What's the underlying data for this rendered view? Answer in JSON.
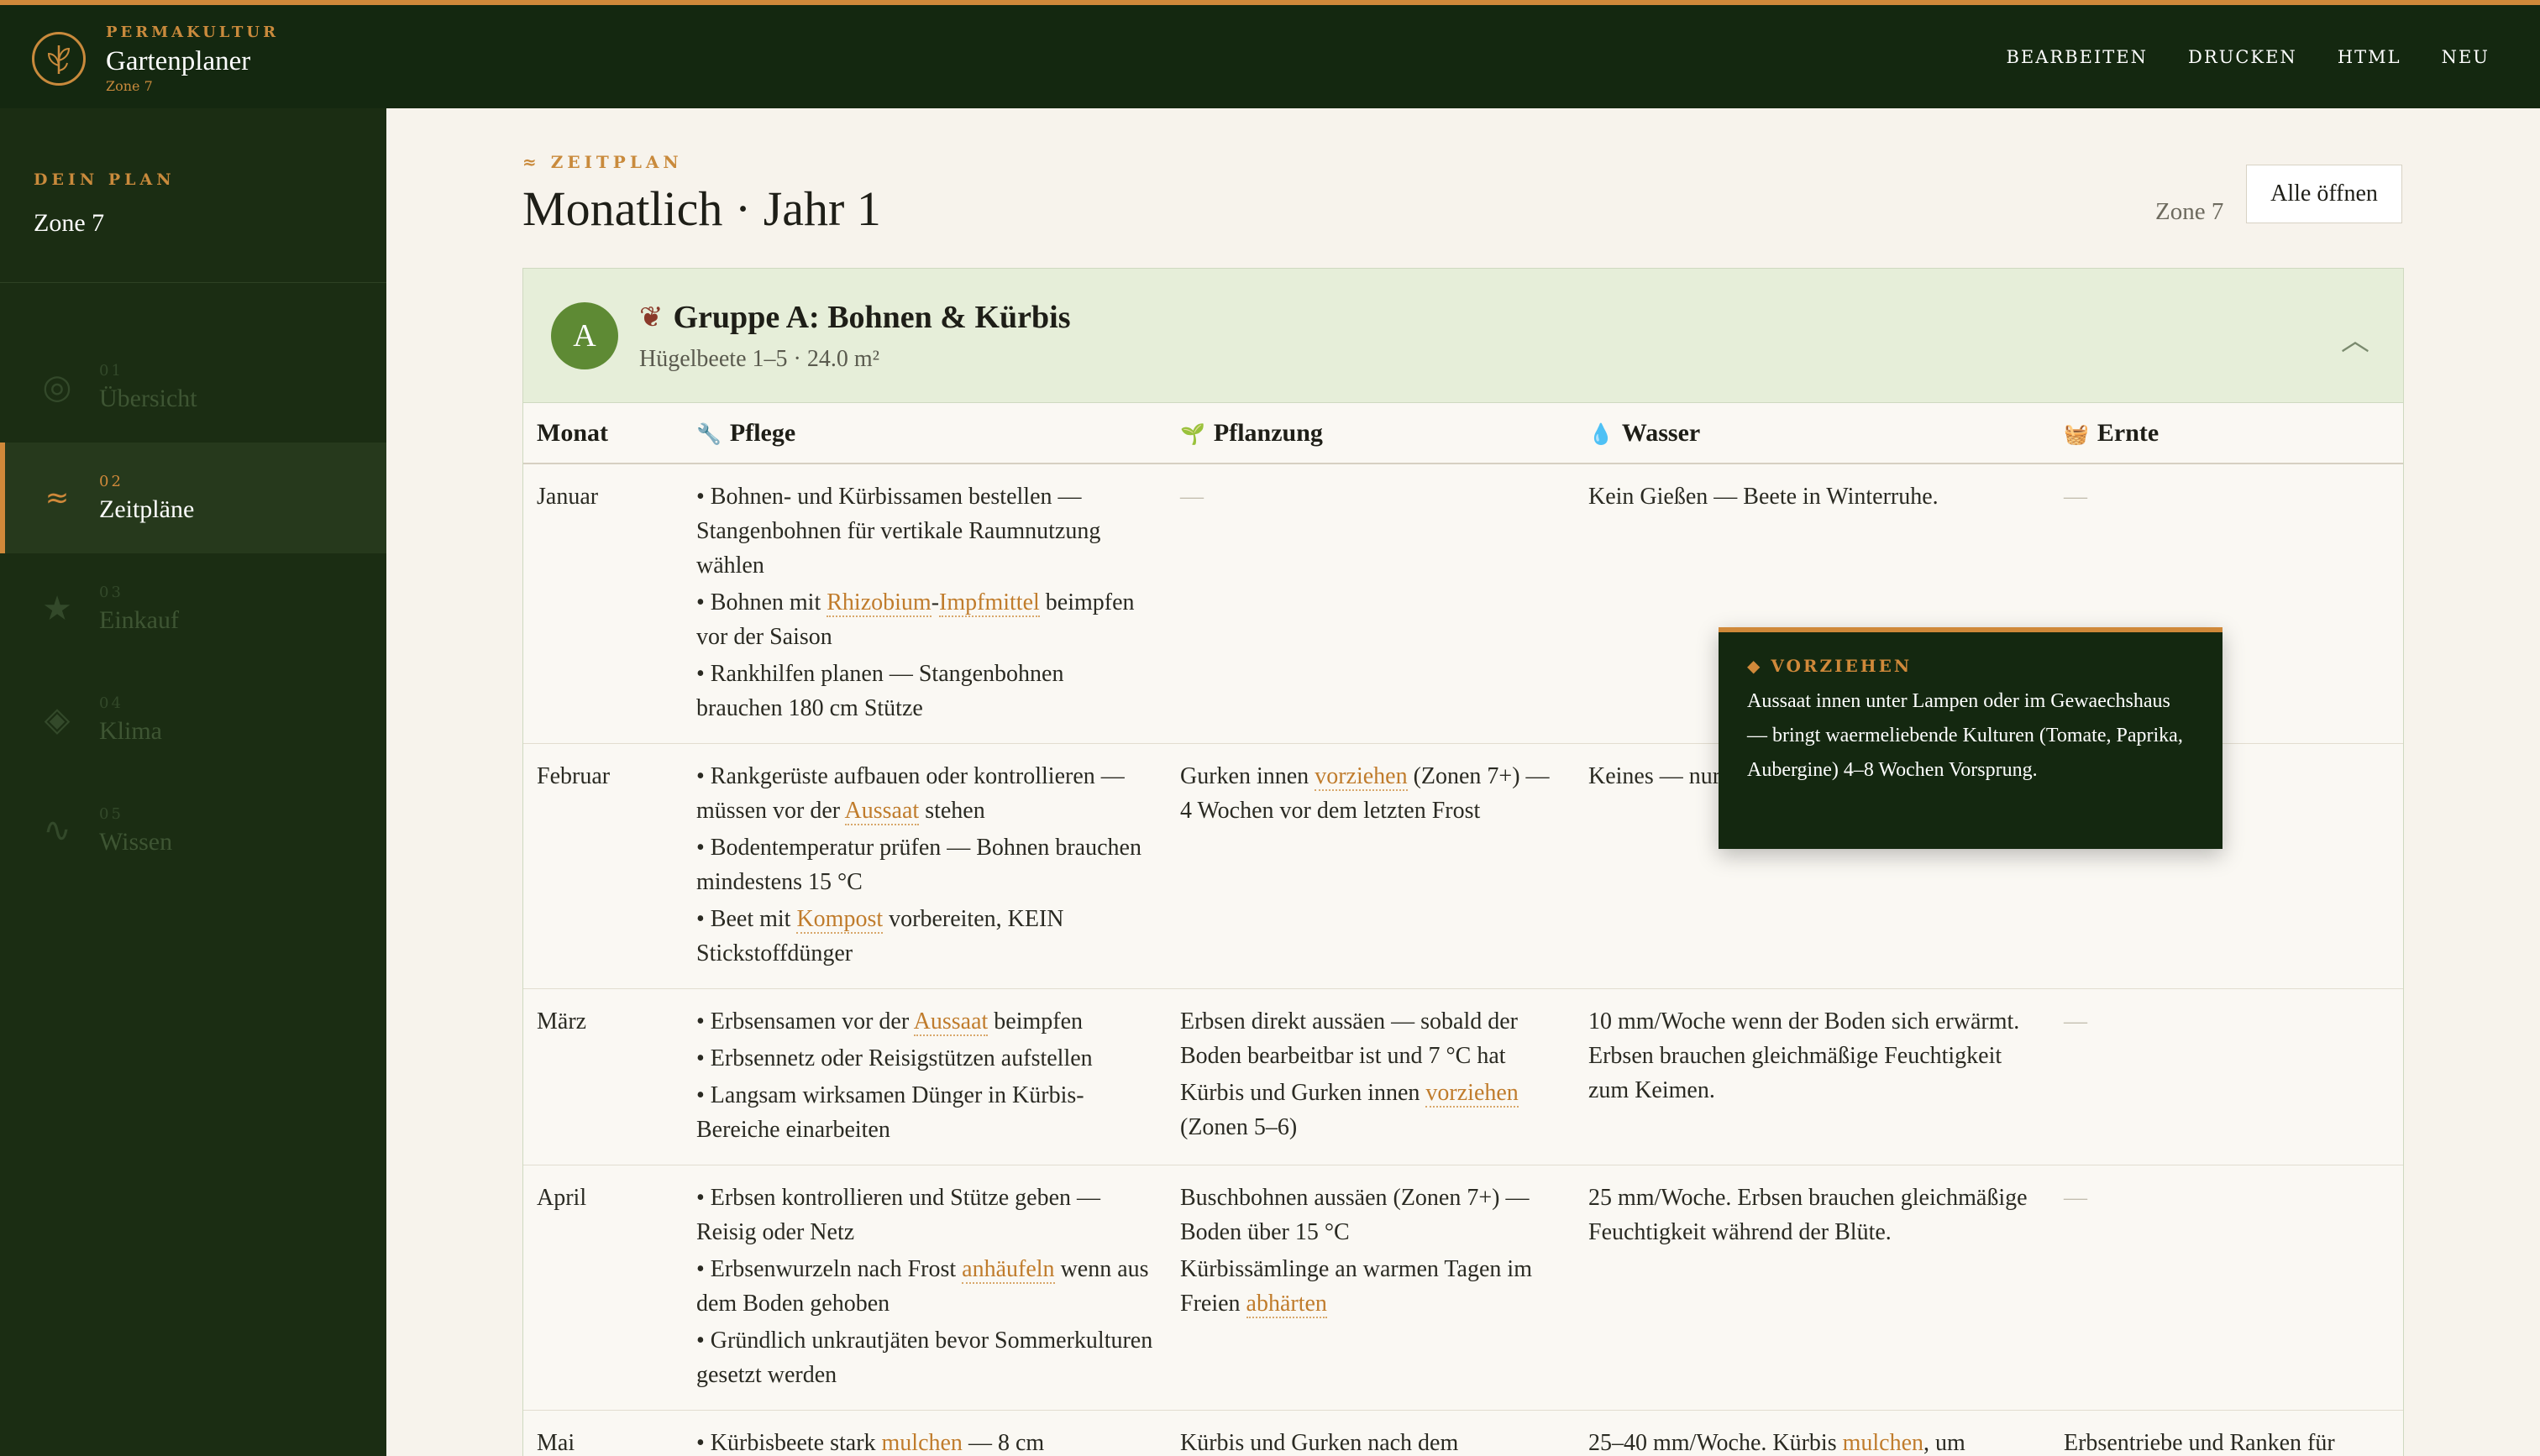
{
  "brand": {
    "eyebrow": "PERMAKULTUR",
    "title": "Gartenplaner",
    "zone": "Zone 7",
    "logo_icon": "leaf-spiral-icon"
  },
  "topnav": [
    "BEARBEITEN",
    "DRUCKEN",
    "HTML",
    "NEU"
  ],
  "sidebar": {
    "label": "DEIN PLAN",
    "zone": "Zone 7",
    "items": [
      {
        "num": "01",
        "name": "Übersicht",
        "icon": "◎",
        "active": false
      },
      {
        "num": "02",
        "name": "Zeitpläne",
        "icon": "≈",
        "active": true
      },
      {
        "num": "03",
        "name": "Einkauf",
        "icon": "★",
        "active": false
      },
      {
        "num": "04",
        "name": "Klima",
        "icon": "◈",
        "active": false
      },
      {
        "num": "05",
        "name": "Wissen",
        "icon": "∿",
        "active": false
      }
    ]
  },
  "header": {
    "eyebrow": "≈ ZEITPLAN",
    "title": "Monatlich · Jahr 1",
    "zone": "Zone 7",
    "open_all": "Alle öffnen"
  },
  "group": {
    "badge": "A",
    "emoji": "❦",
    "title": "Gruppe A: Bohnen & Kürbis",
    "subtitle": "Hügelbeete 1–5 · 24.0 m²",
    "chevron": "︿"
  },
  "table": {
    "headers": [
      {
        "label": "Monat",
        "icon": ""
      },
      {
        "label": "Pflege",
        "icon": "🔧"
      },
      {
        "label": "Pflanzung",
        "icon": "🌱"
      },
      {
        "label": "Wasser",
        "icon": "💧"
      },
      {
        "label": "Ernte",
        "icon": "🧺"
      }
    ],
    "rows": [
      {
        "month": "Januar",
        "care": [
          [
            {
              "t": "• Bohnen- und Kürbissamen bestellen — Stangenbohnen für vertikale Raumnutzung wählen"
            }
          ],
          [
            {
              "t": "• Bohnen mit "
            },
            {
              "t": "Rhizobium",
              "link": true
            },
            {
              "t": "-"
            },
            {
              "t": "Impfmittel",
              "link": true
            },
            {
              "t": " beimpfen vor der Saison"
            }
          ],
          [
            {
              "t": "• Rankhilfen planen — Stangenbohnen brauchen 180 cm Stütze"
            }
          ]
        ],
        "plant": [
          [
            {
              "t": "—",
              "dash": true
            }
          ]
        ],
        "water": [
          [
            {
              "t": "Kein Gießen — Beete in Winterruhe."
            }
          ]
        ],
        "harvest": [
          [
            {
              "t": "—",
              "dash": true
            }
          ]
        ]
      },
      {
        "month": "Februar",
        "care": [
          [
            {
              "t": "• Rankgerüste aufbauen oder kontrollieren — müssen vor der "
            },
            {
              "t": "Aussaat",
              "link": true
            },
            {
              "t": " stehen"
            }
          ],
          [
            {
              "t": "• Bodentemperatur prüfen — Bohnen brauchen mindestens 15 °C"
            }
          ],
          [
            {
              "t": "• Beet mit "
            },
            {
              "t": "Kompost",
              "link": true
            },
            {
              "t": " vorbereiten, KEIN Stickstoffdünger"
            }
          ]
        ],
        "plant": [
          [
            {
              "t": "Gurken innen "
            },
            {
              "t": "vorziehen",
              "link": true
            },
            {
              "t": " (Zonen 7+) — 4 Wochen vor dem letzten Frost"
            }
          ]
        ],
        "water": [
          [
            {
              "t": "Keines — nur bei Innenaussaat beginnen."
            }
          ]
        ],
        "harvest": [
          [
            {
              "t": "—",
              "dash": true
            }
          ]
        ]
      },
      {
        "month": "März",
        "care": [
          [
            {
              "t": "• Erbsensamen vor der "
            },
            {
              "t": "Aussaat",
              "link": true
            },
            {
              "t": " beimpfen"
            }
          ],
          [
            {
              "t": "• Erbsennetz oder Reisigstützen aufstellen"
            }
          ],
          [
            {
              "t": "• Langsam wirksamen Dünger in Kürbis-Bereiche einarbeiten"
            }
          ]
        ],
        "plant": [
          [
            {
              "t": "Erbsen direkt aussäen — sobald der Boden bearbeitbar ist und 7 °C hat"
            }
          ],
          [
            {
              "t": "Kürbis und Gurken innen "
            },
            {
              "t": "vorziehen",
              "link": true
            },
            {
              "t": " (Zonen 5–6)"
            }
          ]
        ],
        "water": [
          [
            {
              "t": "10 mm/Woche wenn der Boden sich erwärmt. Erbsen brauchen gleichmäßige Feuchtigkeit zum Keimen."
            }
          ]
        ],
        "harvest": [
          [
            {
              "t": "—",
              "dash": true
            }
          ]
        ]
      },
      {
        "month": "April",
        "care": [
          [
            {
              "t": "• Erbsen kontrollieren und Stütze geben — Reisig oder Netz"
            }
          ],
          [
            {
              "t": "• Erbsenwurzeln nach Frost "
            },
            {
              "t": "anhäufeln",
              "link": true
            },
            {
              "t": " wenn aus dem Boden gehoben"
            }
          ],
          [
            {
              "t": "• Gründlich unkrautjäten bevor Sommerkulturen gesetzt werden"
            }
          ]
        ],
        "plant": [
          [
            {
              "t": "Buschbohnen aussäen (Zonen 7+) — Boden über 15 °C"
            }
          ],
          [
            {
              "t": "Kürbissämlinge an warmen Tagen im Freien "
            },
            {
              "t": "abhärten",
              "link": true
            }
          ]
        ],
        "water": [
          [
            {
              "t": "25 mm/Woche. Erbsen brauchen gleichmäßige Feuchtigkeit während der Blüte."
            }
          ]
        ],
        "harvest": [
          [
            {
              "t": "—",
              "dash": true
            }
          ]
        ]
      },
      {
        "month": "Mai",
        "care": [
          [
            {
              "t": "• Kürbisbeete stark "
            },
            {
              "t": "mulchen",
              "link": true
            },
            {
              "t": " — 8 cm"
            }
          ]
        ],
        "plant": [
          [
            {
              "t": "Kürbis und Gurken nach dem"
            }
          ]
        ],
        "water": [
          [
            {
              "t": "25–40 mm/Woche. Kürbis "
            },
            {
              "t": "mulchen",
              "link": true
            },
            {
              "t": ", um"
            }
          ]
        ],
        "harvest": [
          [
            {
              "t": "Erbsentriebe und Ranken für"
            }
          ]
        ]
      }
    ]
  },
  "tooltip": {
    "title": "◆ VORZIEHEN",
    "text": "Aussaat innen unter Lampen oder im Gewaechshaus — bringt waermeliebende Kulturen (Tomate, Paprika, Aubergine) 4–8 Wochen Vorsprung."
  }
}
